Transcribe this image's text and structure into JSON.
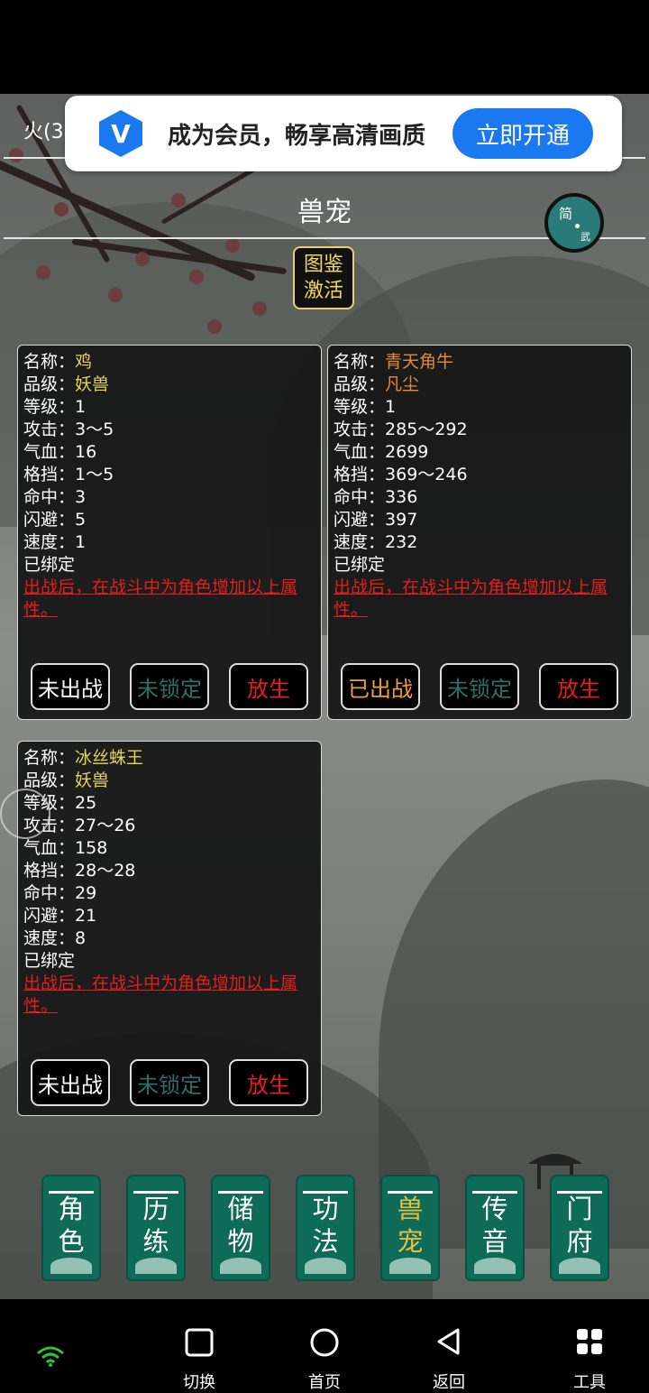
{
  "header": {
    "fragment": "火(3",
    "title": "兽宠",
    "toggle_top": "简",
    "toggle_bottom": "武"
  },
  "vip_banner": {
    "logo_letter": "V",
    "text": "成为会员，畅享高清画质",
    "button": "立即开通",
    "accent": "#1a79f0"
  },
  "dex_button": {
    "line1": "图鉴",
    "line2": "激活"
  },
  "labels": {
    "name": "名称：",
    "grade": "品级：",
    "level": "等级：",
    "attack": "攻击：",
    "hp": "气血：",
    "block": "格挡：",
    "hit": "命中：",
    "dodge": "闪避：",
    "speed": "速度："
  },
  "pets": [
    {
      "name": "鸡",
      "grade": "妖兽",
      "level": "1",
      "attack": "3～5",
      "hp": "16",
      "block": "1～5",
      "hit": "3",
      "dodge": "5",
      "speed": "1",
      "bound": "已绑定",
      "desc": "出战后，在战斗中为角色增加以上属性。",
      "deploy": "未出战",
      "lock": "未锁定",
      "release": "放生"
    },
    {
      "name": "青天角牛",
      "grade": "凡尘",
      "level": "1",
      "attack": "285～292",
      "hp": "2699",
      "block": "369～246",
      "hit": "336",
      "dodge": "397",
      "speed": "232",
      "bound": "已绑定",
      "desc": "出战后，在战斗中为角色增加以上属性。",
      "deploy": "已出战",
      "lock": "未锁定",
      "release": "放生"
    },
    {
      "name": "冰丝蛛王",
      "grade": "妖兽",
      "level": "25",
      "attack": "27～26",
      "hp": "158",
      "block": "28～28",
      "hit": "29",
      "dodge": "21",
      "speed": "8",
      "bound": "已绑定",
      "desc": "出战后，在战斗中为角色增加以上属性。",
      "deploy": "未出战",
      "lock": "未锁定",
      "release": "放生"
    }
  ],
  "bottom_nav": [
    {
      "top": "角",
      "bottom": "色"
    },
    {
      "top": "历",
      "bottom": "练"
    },
    {
      "top": "储",
      "bottom": "物"
    },
    {
      "top": "功",
      "bottom": "法"
    },
    {
      "top": "兽",
      "bottom": "宠",
      "active": true
    },
    {
      "top": "传",
      "bottom": "音"
    },
    {
      "top": "门",
      "bottom": "府"
    }
  ],
  "system_bar": {
    "switch": "切换",
    "home": "首页",
    "back": "返回",
    "tools": "工具"
  },
  "colors": {
    "grade_yellow": "#e3d45a",
    "grade_orange": "#e58a3c",
    "desc_red": "#e41e1e",
    "nav_green": "#0d6b58",
    "active_gold": "#e6c043"
  }
}
